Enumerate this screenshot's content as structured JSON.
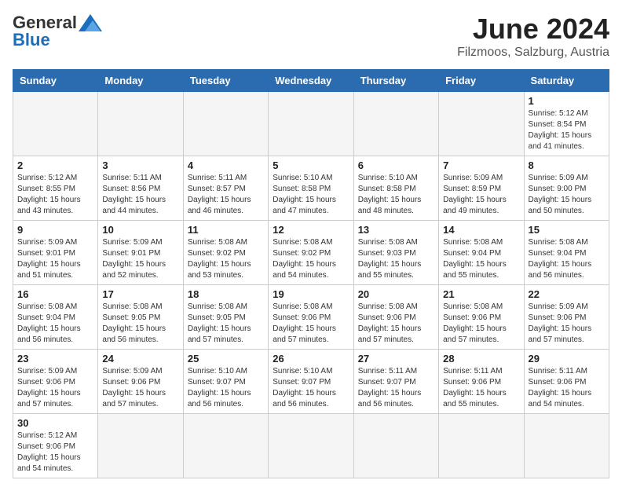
{
  "header": {
    "logo_general": "General",
    "logo_blue": "Blue",
    "title": "June 2024",
    "location": "Filzmoos, Salzburg, Austria"
  },
  "weekdays": [
    "Sunday",
    "Monday",
    "Tuesday",
    "Wednesday",
    "Thursday",
    "Friday",
    "Saturday"
  ],
  "weeks": [
    [
      {
        "day": "",
        "info": ""
      },
      {
        "day": "",
        "info": ""
      },
      {
        "day": "",
        "info": ""
      },
      {
        "day": "",
        "info": ""
      },
      {
        "day": "",
        "info": ""
      },
      {
        "day": "",
        "info": ""
      },
      {
        "day": "1",
        "info": "Sunrise: 5:12 AM\nSunset: 8:54 PM\nDaylight: 15 hours\nand 41 minutes."
      }
    ],
    [
      {
        "day": "2",
        "info": "Sunrise: 5:12 AM\nSunset: 8:55 PM\nDaylight: 15 hours\nand 43 minutes."
      },
      {
        "day": "3",
        "info": "Sunrise: 5:11 AM\nSunset: 8:56 PM\nDaylight: 15 hours\nand 44 minutes."
      },
      {
        "day": "4",
        "info": "Sunrise: 5:11 AM\nSunset: 8:57 PM\nDaylight: 15 hours\nand 46 minutes."
      },
      {
        "day": "5",
        "info": "Sunrise: 5:10 AM\nSunset: 8:58 PM\nDaylight: 15 hours\nand 47 minutes."
      },
      {
        "day": "6",
        "info": "Sunrise: 5:10 AM\nSunset: 8:58 PM\nDaylight: 15 hours\nand 48 minutes."
      },
      {
        "day": "7",
        "info": "Sunrise: 5:09 AM\nSunset: 8:59 PM\nDaylight: 15 hours\nand 49 minutes."
      },
      {
        "day": "8",
        "info": "Sunrise: 5:09 AM\nSunset: 9:00 PM\nDaylight: 15 hours\nand 50 minutes."
      }
    ],
    [
      {
        "day": "9",
        "info": "Sunrise: 5:09 AM\nSunset: 9:01 PM\nDaylight: 15 hours\nand 51 minutes."
      },
      {
        "day": "10",
        "info": "Sunrise: 5:09 AM\nSunset: 9:01 PM\nDaylight: 15 hours\nand 52 minutes."
      },
      {
        "day": "11",
        "info": "Sunrise: 5:08 AM\nSunset: 9:02 PM\nDaylight: 15 hours\nand 53 minutes."
      },
      {
        "day": "12",
        "info": "Sunrise: 5:08 AM\nSunset: 9:02 PM\nDaylight: 15 hours\nand 54 minutes."
      },
      {
        "day": "13",
        "info": "Sunrise: 5:08 AM\nSunset: 9:03 PM\nDaylight: 15 hours\nand 55 minutes."
      },
      {
        "day": "14",
        "info": "Sunrise: 5:08 AM\nSunset: 9:04 PM\nDaylight: 15 hours\nand 55 minutes."
      },
      {
        "day": "15",
        "info": "Sunrise: 5:08 AM\nSunset: 9:04 PM\nDaylight: 15 hours\nand 56 minutes."
      }
    ],
    [
      {
        "day": "16",
        "info": "Sunrise: 5:08 AM\nSunset: 9:04 PM\nDaylight: 15 hours\nand 56 minutes."
      },
      {
        "day": "17",
        "info": "Sunrise: 5:08 AM\nSunset: 9:05 PM\nDaylight: 15 hours\nand 56 minutes."
      },
      {
        "day": "18",
        "info": "Sunrise: 5:08 AM\nSunset: 9:05 PM\nDaylight: 15 hours\nand 57 minutes."
      },
      {
        "day": "19",
        "info": "Sunrise: 5:08 AM\nSunset: 9:06 PM\nDaylight: 15 hours\nand 57 minutes."
      },
      {
        "day": "20",
        "info": "Sunrise: 5:08 AM\nSunset: 9:06 PM\nDaylight: 15 hours\nand 57 minutes."
      },
      {
        "day": "21",
        "info": "Sunrise: 5:08 AM\nSunset: 9:06 PM\nDaylight: 15 hours\nand 57 minutes."
      },
      {
        "day": "22",
        "info": "Sunrise: 5:09 AM\nSunset: 9:06 PM\nDaylight: 15 hours\nand 57 minutes."
      }
    ],
    [
      {
        "day": "23",
        "info": "Sunrise: 5:09 AM\nSunset: 9:06 PM\nDaylight: 15 hours\nand 57 minutes."
      },
      {
        "day": "24",
        "info": "Sunrise: 5:09 AM\nSunset: 9:06 PM\nDaylight: 15 hours\nand 57 minutes."
      },
      {
        "day": "25",
        "info": "Sunrise: 5:10 AM\nSunset: 9:07 PM\nDaylight: 15 hours\nand 56 minutes."
      },
      {
        "day": "26",
        "info": "Sunrise: 5:10 AM\nSunset: 9:07 PM\nDaylight: 15 hours\nand 56 minutes."
      },
      {
        "day": "27",
        "info": "Sunrise: 5:11 AM\nSunset: 9:07 PM\nDaylight: 15 hours\nand 56 minutes."
      },
      {
        "day": "28",
        "info": "Sunrise: 5:11 AM\nSunset: 9:06 PM\nDaylight: 15 hours\nand 55 minutes."
      },
      {
        "day": "29",
        "info": "Sunrise: 5:11 AM\nSunset: 9:06 PM\nDaylight: 15 hours\nand 54 minutes."
      }
    ],
    [
      {
        "day": "30",
        "info": "Sunrise: 5:12 AM\nSunset: 9:06 PM\nDaylight: 15 hours\nand 54 minutes."
      },
      {
        "day": "",
        "info": ""
      },
      {
        "day": "",
        "info": ""
      },
      {
        "day": "",
        "info": ""
      },
      {
        "day": "",
        "info": ""
      },
      {
        "day": "",
        "info": ""
      },
      {
        "day": "",
        "info": ""
      }
    ]
  ]
}
